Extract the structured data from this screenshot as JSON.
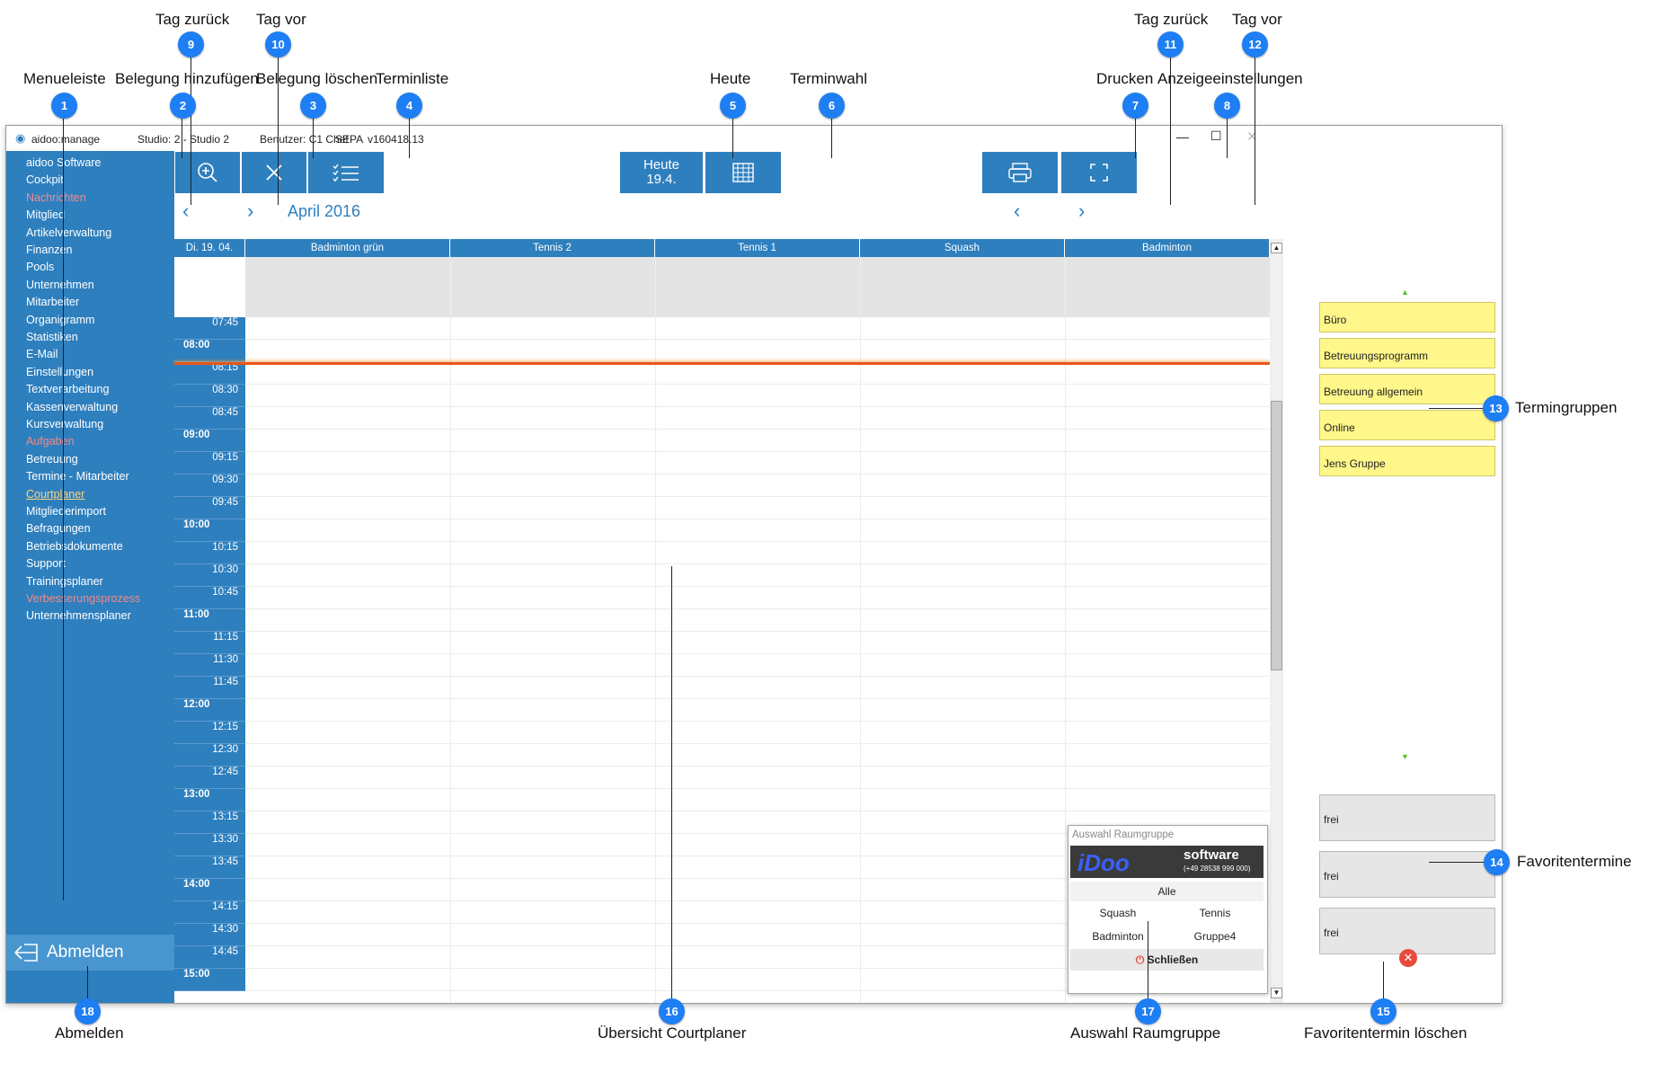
{
  "annotations": [
    {
      "n": "1",
      "label": "Menueleiste"
    },
    {
      "n": "2",
      "label": "Belegung hinzufügen"
    },
    {
      "n": "3",
      "label": "Belegung löschen"
    },
    {
      "n": "4",
      "label": "Terminliste"
    },
    {
      "n": "5",
      "label": "Heute"
    },
    {
      "n": "6",
      "label": "Terminwahl"
    },
    {
      "n": "7",
      "label": "Drucken"
    },
    {
      "n": "8",
      "label": "Anzeigeeinstellungen"
    },
    {
      "n": "9",
      "label": "Tag zurück"
    },
    {
      "n": "10",
      "label": "Tag vor"
    },
    {
      "n": "11",
      "label": "Tag zurück"
    },
    {
      "n": "12",
      "label": "Tag vor"
    },
    {
      "n": "13",
      "label": "Termingruppen"
    },
    {
      "n": "14",
      "label": "Favoritentermine"
    },
    {
      "n": "15",
      "label": "Favoritentermin löschen"
    },
    {
      "n": "16",
      "label": "Übersicht Courtplaner"
    },
    {
      "n": "17",
      "label": "Auswahl Raumgruppe"
    },
    {
      "n": "18",
      "label": "Abmelden"
    }
  ],
  "titlebar": {
    "app": "aidoo:manage",
    "studio": "Studio: 2 - Studio 2",
    "user": "Benutzer: C1 Chef",
    "sepa": "SEPA",
    "version": "v160418.13"
  },
  "menu": [
    {
      "label": "aidoo Software",
      "style": "normal"
    },
    {
      "label": "Cockpit",
      "style": "normal"
    },
    {
      "label": "Nachrichten",
      "style": "red"
    },
    {
      "label": "Mitglied",
      "style": "normal"
    },
    {
      "label": "Artikelverwaltung",
      "style": "normal"
    },
    {
      "label": "Finanzen",
      "style": "normal"
    },
    {
      "label": "Pools",
      "style": "normal"
    },
    {
      "label": "Unternehmen",
      "style": "normal"
    },
    {
      "label": "Mitarbeiter",
      "style": "normal"
    },
    {
      "label": "Organigramm",
      "style": "normal"
    },
    {
      "label": "Statistiken",
      "style": "normal"
    },
    {
      "label": "E-Mail",
      "style": "normal"
    },
    {
      "label": "Einstellungen",
      "style": "normal"
    },
    {
      "label": "Textverarbeitung",
      "style": "normal"
    },
    {
      "label": "Kassenverwaltung",
      "style": "normal"
    },
    {
      "label": "Kursverwaltung",
      "style": "normal"
    },
    {
      "label": "Aufgaben",
      "style": "red"
    },
    {
      "label": "Betreuung",
      "style": "normal"
    },
    {
      "label": "Termine - Mitarbeiter",
      "style": "normal"
    },
    {
      "label": "Courtplaner",
      "style": "link"
    },
    {
      "label": "Mitgliederimport",
      "style": "normal"
    },
    {
      "label": "Befragungen",
      "style": "normal"
    },
    {
      "label": "Betriebsdokumente",
      "style": "normal"
    },
    {
      "label": "Support",
      "style": "normal"
    },
    {
      "label": "Trainingsplaner",
      "style": "normal"
    },
    {
      "label": "Verbesserungsprozess",
      "style": "red"
    },
    {
      "label": "Unternehmensplaner",
      "style": "normal"
    }
  ],
  "logout_label": "Abmelden",
  "today_button": {
    "line1": "Heute",
    "line2": "19.4."
  },
  "month_label": "April 2016",
  "day_label": "Di. 19. 04.",
  "courts": [
    "Badminton grün",
    "Tennis 2",
    "Tennis 1",
    "Squash",
    "Badminton"
  ],
  "times": [
    "07:45",
    "08:00",
    "08:15",
    "08:30",
    "08:45",
    "09:00",
    "09:15",
    "09:30",
    "09:45",
    "10:00",
    "10:15",
    "10:30",
    "10:45",
    "11:00",
    "11:15",
    "11:30",
    "11:45",
    "12:00",
    "12:15",
    "12:30",
    "12:45",
    "13:00",
    "13:15",
    "13:30",
    "13:45",
    "14:00",
    "14:15",
    "14:30",
    "14:45",
    "15:00"
  ],
  "groups": [
    "Büro",
    "Betreuungsprogramm",
    "Betreuung allgemein",
    "Online",
    "Jens Gruppe"
  ],
  "favorites": [
    "frei",
    "frei",
    "frei"
  ],
  "raumgruppe": {
    "title": "Auswahl Raumgruppe",
    "logo_main": "iDoo",
    "logo_sub": "software",
    "logo_phone": "(+49 28538 999 000)",
    "all": "Alle",
    "items": [
      "Squash",
      "Tennis",
      "Badminton",
      "Gruppe4"
    ],
    "close": "Schließen"
  },
  "colors": {
    "accent": "#2e7fbe",
    "now_line": "#e8571a",
    "group_bg": "#fff78a",
    "badge": "#1e7ef3"
  }
}
